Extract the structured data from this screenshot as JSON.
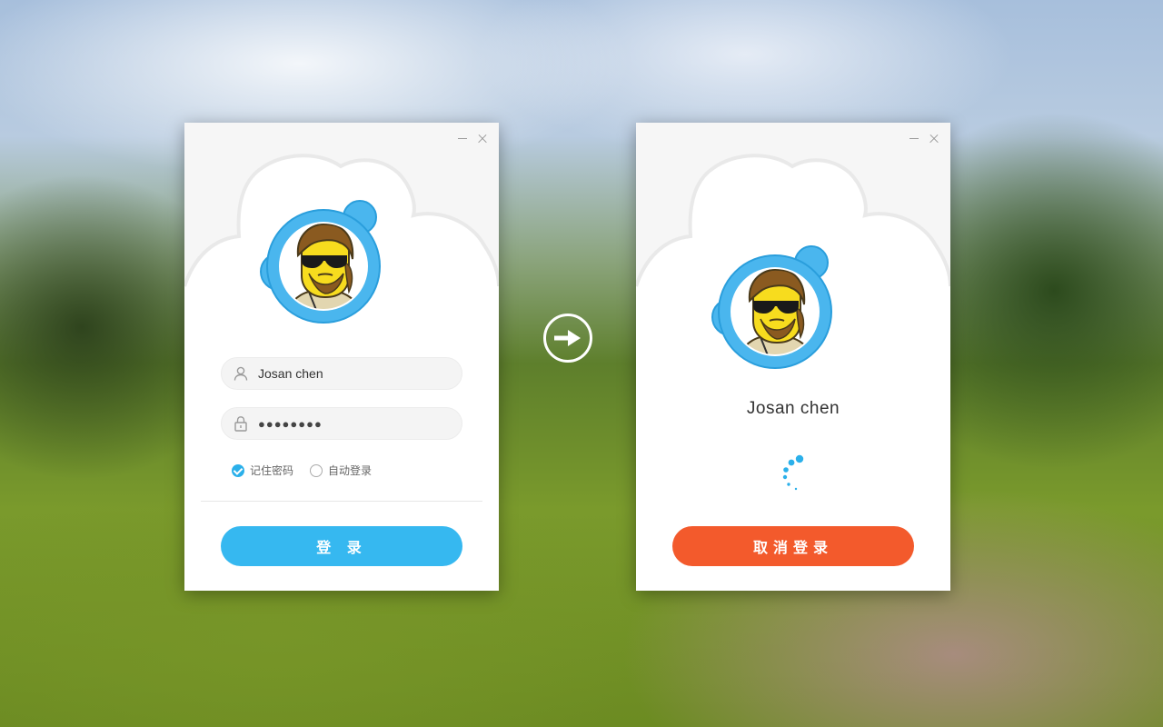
{
  "login_panel": {
    "username_value": "Josan chen",
    "password_value": "●●●●●●●●",
    "remember_password_label": "记住密码",
    "remember_password_checked": true,
    "auto_login_label": "自动登录",
    "auto_login_checked": false,
    "login_button_label": "登 录"
  },
  "loading_panel": {
    "username": "Josan chen",
    "cancel_button_label": "取消登录"
  },
  "icons": {
    "minimize": "minimize-icon",
    "close": "close-icon",
    "user": "user-icon",
    "lock": "lock-icon",
    "arrow": "arrow-right-icon",
    "spinner": "loading-spinner-icon"
  },
  "colors": {
    "accent_blue": "#36b8f0",
    "cancel_orange": "#f35a2c",
    "avatar_ring": "#4ab6ee",
    "avatar_face": "#f7dc1e"
  }
}
